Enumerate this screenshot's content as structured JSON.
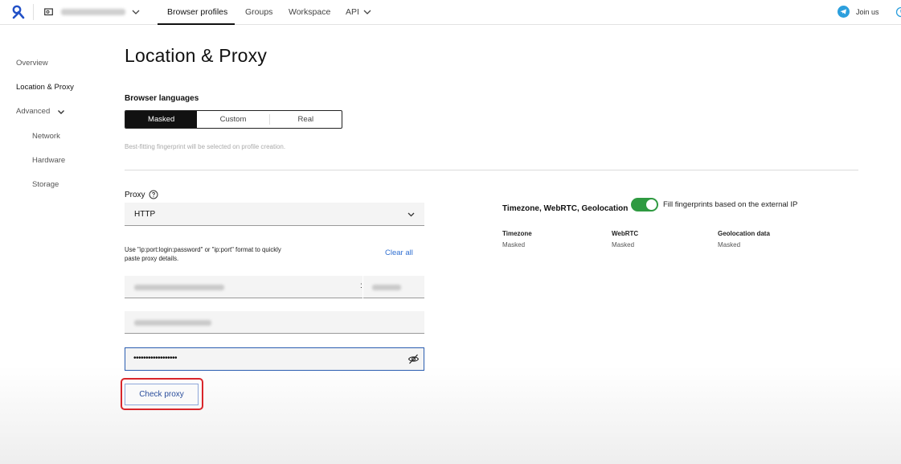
{
  "topbar": {
    "nav": [
      "Browser profiles",
      "Groups",
      "Workspace",
      "API"
    ],
    "join_label": "Join us"
  },
  "sidebar": {
    "items": [
      "Overview",
      "Location & Proxy",
      "Advanced",
      "Network",
      "Hardware",
      "Storage"
    ]
  },
  "main": {
    "title": "Location & Proxy",
    "browser_languages": {
      "label": "Browser languages",
      "options": [
        "Masked",
        "Custom",
        "Real"
      ],
      "selected": "Masked",
      "hint": "Best-fitting fingerprint will be selected on profile creation."
    },
    "proxy": {
      "label": "Proxy",
      "type_value": "HTTP",
      "paste_hint": "Use \"ip:port:login:password\" or \"ip:port\" format to quickly paste proxy details.",
      "clear_all": "Clear all",
      "host_port_separator": ":",
      "password_masked": "••••••••••••••••••",
      "check_button": "Check proxy"
    },
    "fingerprint": {
      "title": "Timezone, WebRTC, Geolocation",
      "toggle_label": "Fill fingerprints based on the external IP",
      "toggle_on": true,
      "columns": [
        {
          "header": "Timezone",
          "value": "Masked"
        },
        {
          "header": "WebRTC",
          "value": "Masked"
        },
        {
          "header": "Geolocation data",
          "value": "Masked"
        }
      ]
    }
  },
  "colors": {
    "accent_link": "#2f6fd1",
    "toggle_on": "#2f9a41",
    "highlight_box": "#d9262b",
    "focus_border": "#2a5db0"
  }
}
